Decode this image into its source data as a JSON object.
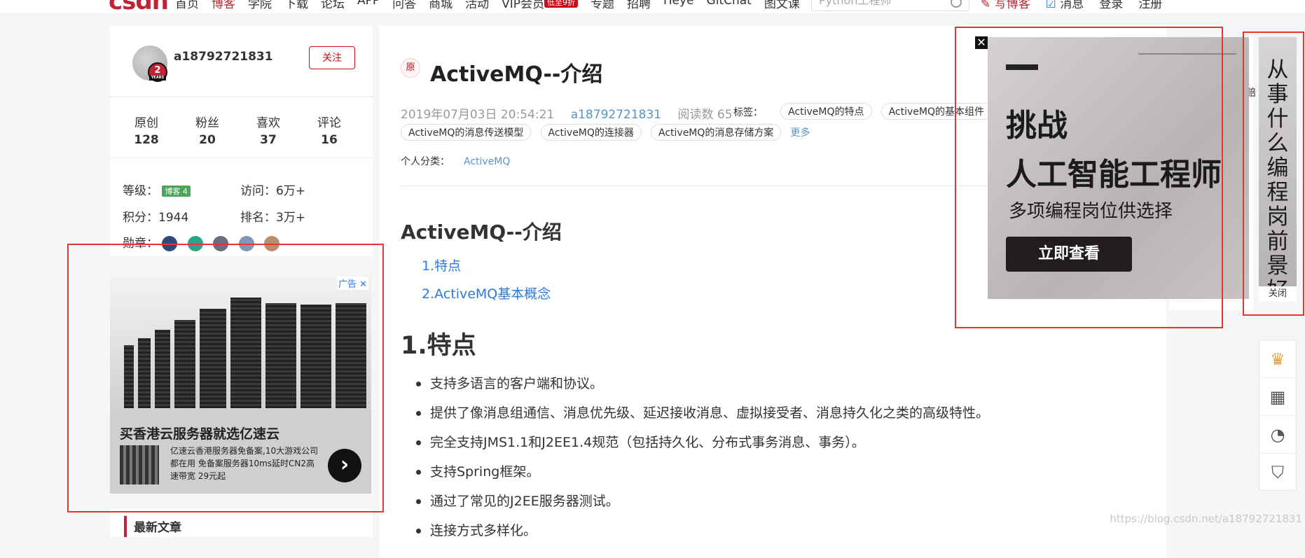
{
  "topnav": {
    "logo": "csdn",
    "links": [
      "首页",
      "博客",
      "学院",
      "下载",
      "论坛",
      "APP",
      "问答",
      "商城",
      "活动",
      "VIP会员",
      "专题",
      "招聘",
      "ITeye",
      "GitChat",
      "图文课"
    ],
    "vip_tag": "低至9折",
    "search_placeholder": "Python工程师",
    "right": [
      "写博客",
      "消息",
      "登录",
      "注册"
    ]
  },
  "profile": {
    "username": "a18792721831",
    "years_badge": "2",
    "years_label": "YEARS",
    "follow": "关注"
  },
  "stats": [
    {
      "label": "原创",
      "value": "128"
    },
    {
      "label": "粉丝",
      "value": "20"
    },
    {
      "label": "喜欢",
      "value": "37"
    },
    {
      "label": "评论",
      "value": "16"
    }
  ],
  "levels": {
    "level_label": "等级：",
    "level_badge": "博客 4",
    "visits_label": "访问：",
    "visits_value": "6万+",
    "points_label": "积分：",
    "points_value": "1944",
    "rank_label": "排名：",
    "rank_value": "3万+",
    "medals_label": "勋章："
  },
  "ad_left": {
    "ad_label": "广告",
    "headline": "买香港云服务器就选亿速云",
    "desc": "亿速云香港服务器免备案,10大游戏公司都在用 免备案服务器10ms延时CN2高速带宽 29元起"
  },
  "recent": {
    "title": "最新文章"
  },
  "article": {
    "original": "原",
    "title": "ActiveMQ--介绍",
    "date": "2019年07月03日 20:54:21",
    "author": "a18792721831",
    "reads": "阅读数 65",
    "tags_label": "标签：",
    "tags": [
      "ActiveMQ的特点",
      "ActiveMQ的基本组件",
      "ActiveMQ的消息传送模型",
      "ActiveMQ的连接器",
      "ActiveMQ的消息存储方案"
    ],
    "more": "更多",
    "category_label": "个人分类：",
    "category": "ActiveMQ",
    "h2": "ActiveMQ--介绍",
    "toc": [
      "1.特点",
      "2.ActiveMQ基本概念"
    ],
    "h1": "1.特点",
    "bullets": [
      "支持多语言的客户端和协议。",
      "提供了像消息组通信、消息优先级、延迟接收消息、虚拟接受者、消息持久化之类的高级特性。",
      "完全支持JMS1.1和J2EE1.4规范（包括持久化、分布式事务消息、事务）。",
      "支持Spring框架。",
      "通过了常见的J2EE服务器测试。",
      "连接方式多样化。"
    ]
  },
  "ad_right": {
    "close": "✕",
    "line1": "挑战",
    "line2": "人工智能工程师",
    "line3": "多项编程岗位供选择",
    "cta": "立即查看"
  },
  "ad_side": {
    "text": "从事什么编程岗前景好",
    "close": "关闭"
  },
  "edge_text": "赔",
  "tools": [
    "crown-icon",
    "qrcode-icon",
    "chat-icon",
    "shield-icon"
  ],
  "watermark": "https://blog.csdn.net/a18792721831"
}
